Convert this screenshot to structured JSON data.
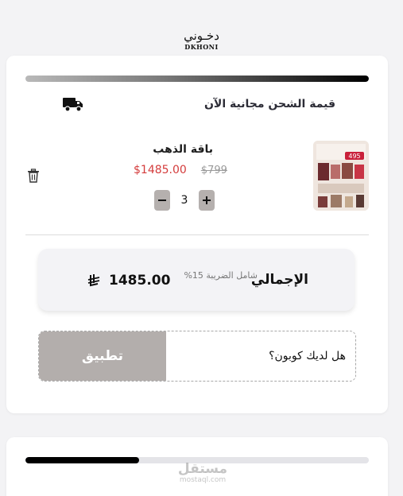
{
  "brand": {
    "name_ar": "دخـوني",
    "name_en": "DKHONI"
  },
  "cart": {
    "shipping_progress": 1.0,
    "shipping_text": "قيمة الشحن مجانية الآن",
    "item": {
      "name": "باقة الذهب",
      "price_new": "$1485.00",
      "price_old": "$799",
      "quantity": "3",
      "thumb_badge": "495"
    },
    "summary": {
      "total_label": "الإجمالي",
      "tax_note": "شامل الضريبة 15%",
      "total_value": "1485.00"
    },
    "coupon": {
      "placeholder": "هل لديك كوبون؟",
      "apply_label": "تطبيق"
    }
  },
  "card2": {
    "progress": 0.33
  },
  "watermark": {
    "ar": "مستقل",
    "en": "mostaql.com"
  },
  "colors": {
    "price_new": "#d43c3c",
    "button_gray": "#b3aeac",
    "progress_dark": "#000000"
  },
  "icons": [
    "truck-icon",
    "trash-icon",
    "minus-icon",
    "plus-icon",
    "riyal-icon"
  ]
}
